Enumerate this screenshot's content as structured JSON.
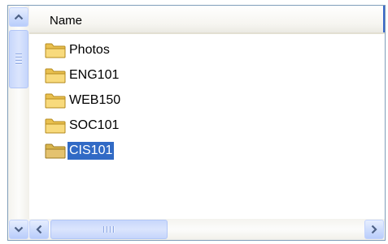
{
  "list_header": {
    "name_column": "Name"
  },
  "items": [
    {
      "label": "Photos",
      "icon": "folder-icon",
      "selected": false
    },
    {
      "label": "ENG101",
      "icon": "folder-icon",
      "selected": false
    },
    {
      "label": "WEB150",
      "icon": "folder-icon",
      "selected": false
    },
    {
      "label": "SOC101",
      "icon": "folder-icon",
      "selected": false
    },
    {
      "label": "CIS101",
      "icon": "folder-icon",
      "selected": true
    }
  ],
  "scrollbars": {
    "vertical_up_icon": "chevron-up-icon",
    "vertical_down_icon": "chevron-down-icon",
    "horizontal_left_icon": "chevron-left-icon",
    "horizontal_right_icon": "chevron-right-icon"
  },
  "colors": {
    "selection": "#316ac5",
    "folder": "#f5d36b",
    "scroll_button": "#cbdafc",
    "border": "#7f9db9"
  }
}
